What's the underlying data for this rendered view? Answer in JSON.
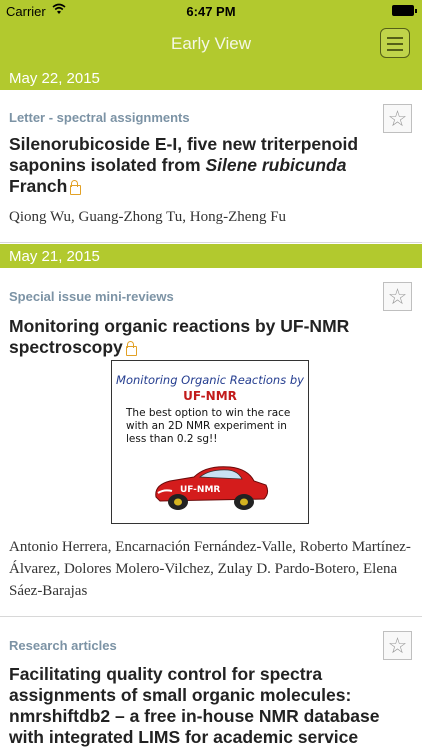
{
  "status_bar": {
    "carrier": "Carrier",
    "time": "6:47 PM"
  },
  "nav": {
    "title": "Early View",
    "menu_icon": "hamburger-menu-icon"
  },
  "sections": [
    {
      "date": "May 22, 2015",
      "articles": [
        {
          "category": "Letter - spectral assignments",
          "title_main": "Silenorubicoside E-I, five new triterpenoid saponins isolated from ",
          "title_italic": "Silene rubicunda",
          "title_end": " Franch",
          "authors": "Qiong Wu, Guang-Zhong Tu, Hong-Zheng Fu"
        }
      ]
    },
    {
      "date": "May 21, 2015",
      "articles": [
        {
          "category": "Special issue mini-reviews",
          "title": "Monitoring organic reactions by UF-NMR spectroscopy",
          "graphic": {
            "line1": "Monitoring Organic Reactions by",
            "line2": "UF-NMR",
            "line3": "The best option to win the race with an 2D NMR experiment in less than 0.2 sg!!",
            "car_label": "UF-NMR"
          },
          "authors": "Antonio Herrera, Encarnación Fernández-Valle, Roberto Martínez-Álvarez, Dolores Molero-Vilchez, Zulay D. Pardo-Botero, Elena Sáez-Barajas"
        },
        {
          "category": "Research articles",
          "title": "Facilitating quality control for spectra assignments of small organic molecules: nmrshiftdb2 – a free in-house NMR database with integrated LIMS for academic service laboratories"
        }
      ]
    }
  ],
  "colors": {
    "accent": "#b2c92e",
    "category": "#7c93a5",
    "lock": "#e2a126"
  }
}
